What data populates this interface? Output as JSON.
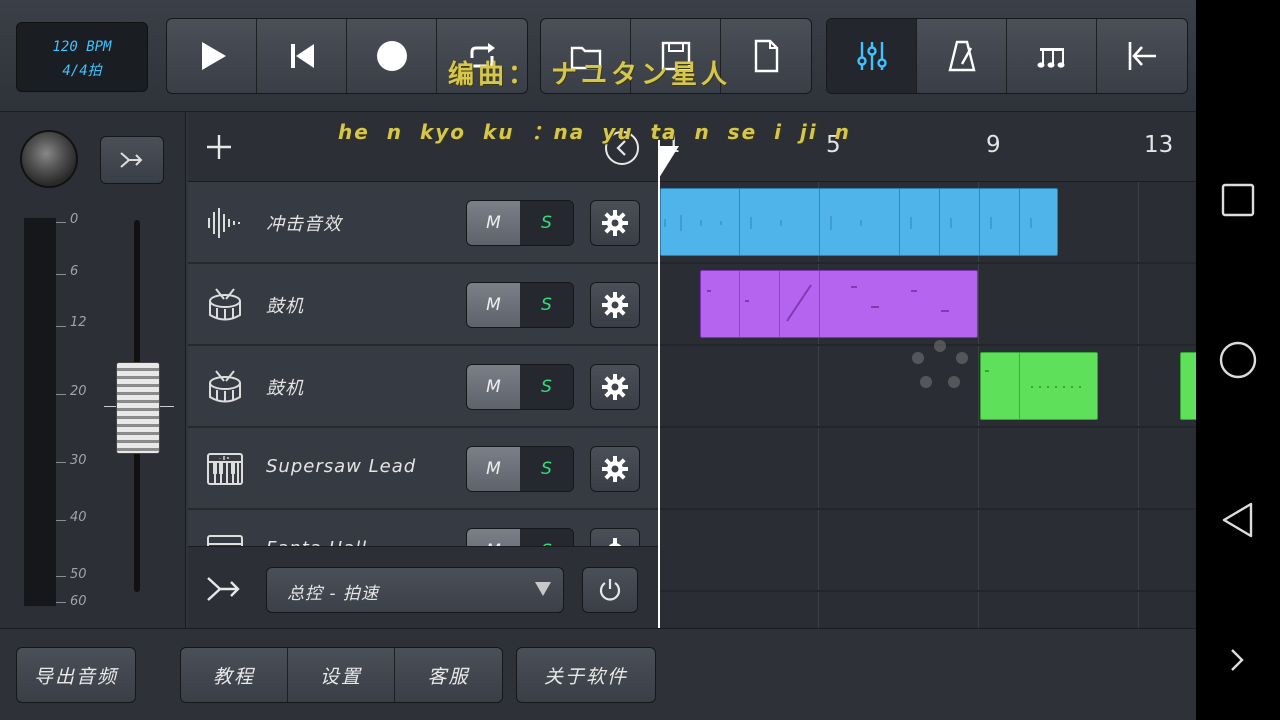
{
  "transport": {
    "bpm": "120 BPM",
    "time_signature": "4/4拍"
  },
  "overlay": {
    "lyric_line1": "编曲： ナユタン星人",
    "lyric_line2": "he n kyo ku ：na yu ta n se i ji n"
  },
  "ruler": {
    "bar_labels": [
      "1",
      "5",
      "9",
      "13"
    ]
  },
  "tracks": [
    {
      "name": "冲击音效",
      "icon": "waveform-icon",
      "mute": "M",
      "solo": "S"
    },
    {
      "name": "鼓机",
      "icon": "drum-icon",
      "mute": "M",
      "solo": "S"
    },
    {
      "name": "鼓机",
      "icon": "drum-icon",
      "mute": "M",
      "solo": "S"
    },
    {
      "name": "Supersaw Lead",
      "icon": "keyboard-icon",
      "mute": "M",
      "solo": "S"
    },
    {
      "name": "Fanta Hall",
      "icon": "keyboard-icon",
      "mute": "M",
      "solo": "S"
    }
  ],
  "master": {
    "select_value": "总控 - 拍速",
    "fader_scale": [
      "0",
      "6",
      "12",
      "20",
      "30",
      "40",
      "50",
      "60"
    ]
  },
  "bottom": {
    "export_audio": "导出音频",
    "tutorial": "教程",
    "settings": "设置",
    "support": "客服",
    "about": "关于软件"
  },
  "colors": {
    "clip_blue": "#4fb4ea",
    "clip_purple": "#b564f0",
    "clip_green": "#5ee05a",
    "accent_cyan": "#3fc3ff",
    "solo_green": "#2ee07a"
  }
}
